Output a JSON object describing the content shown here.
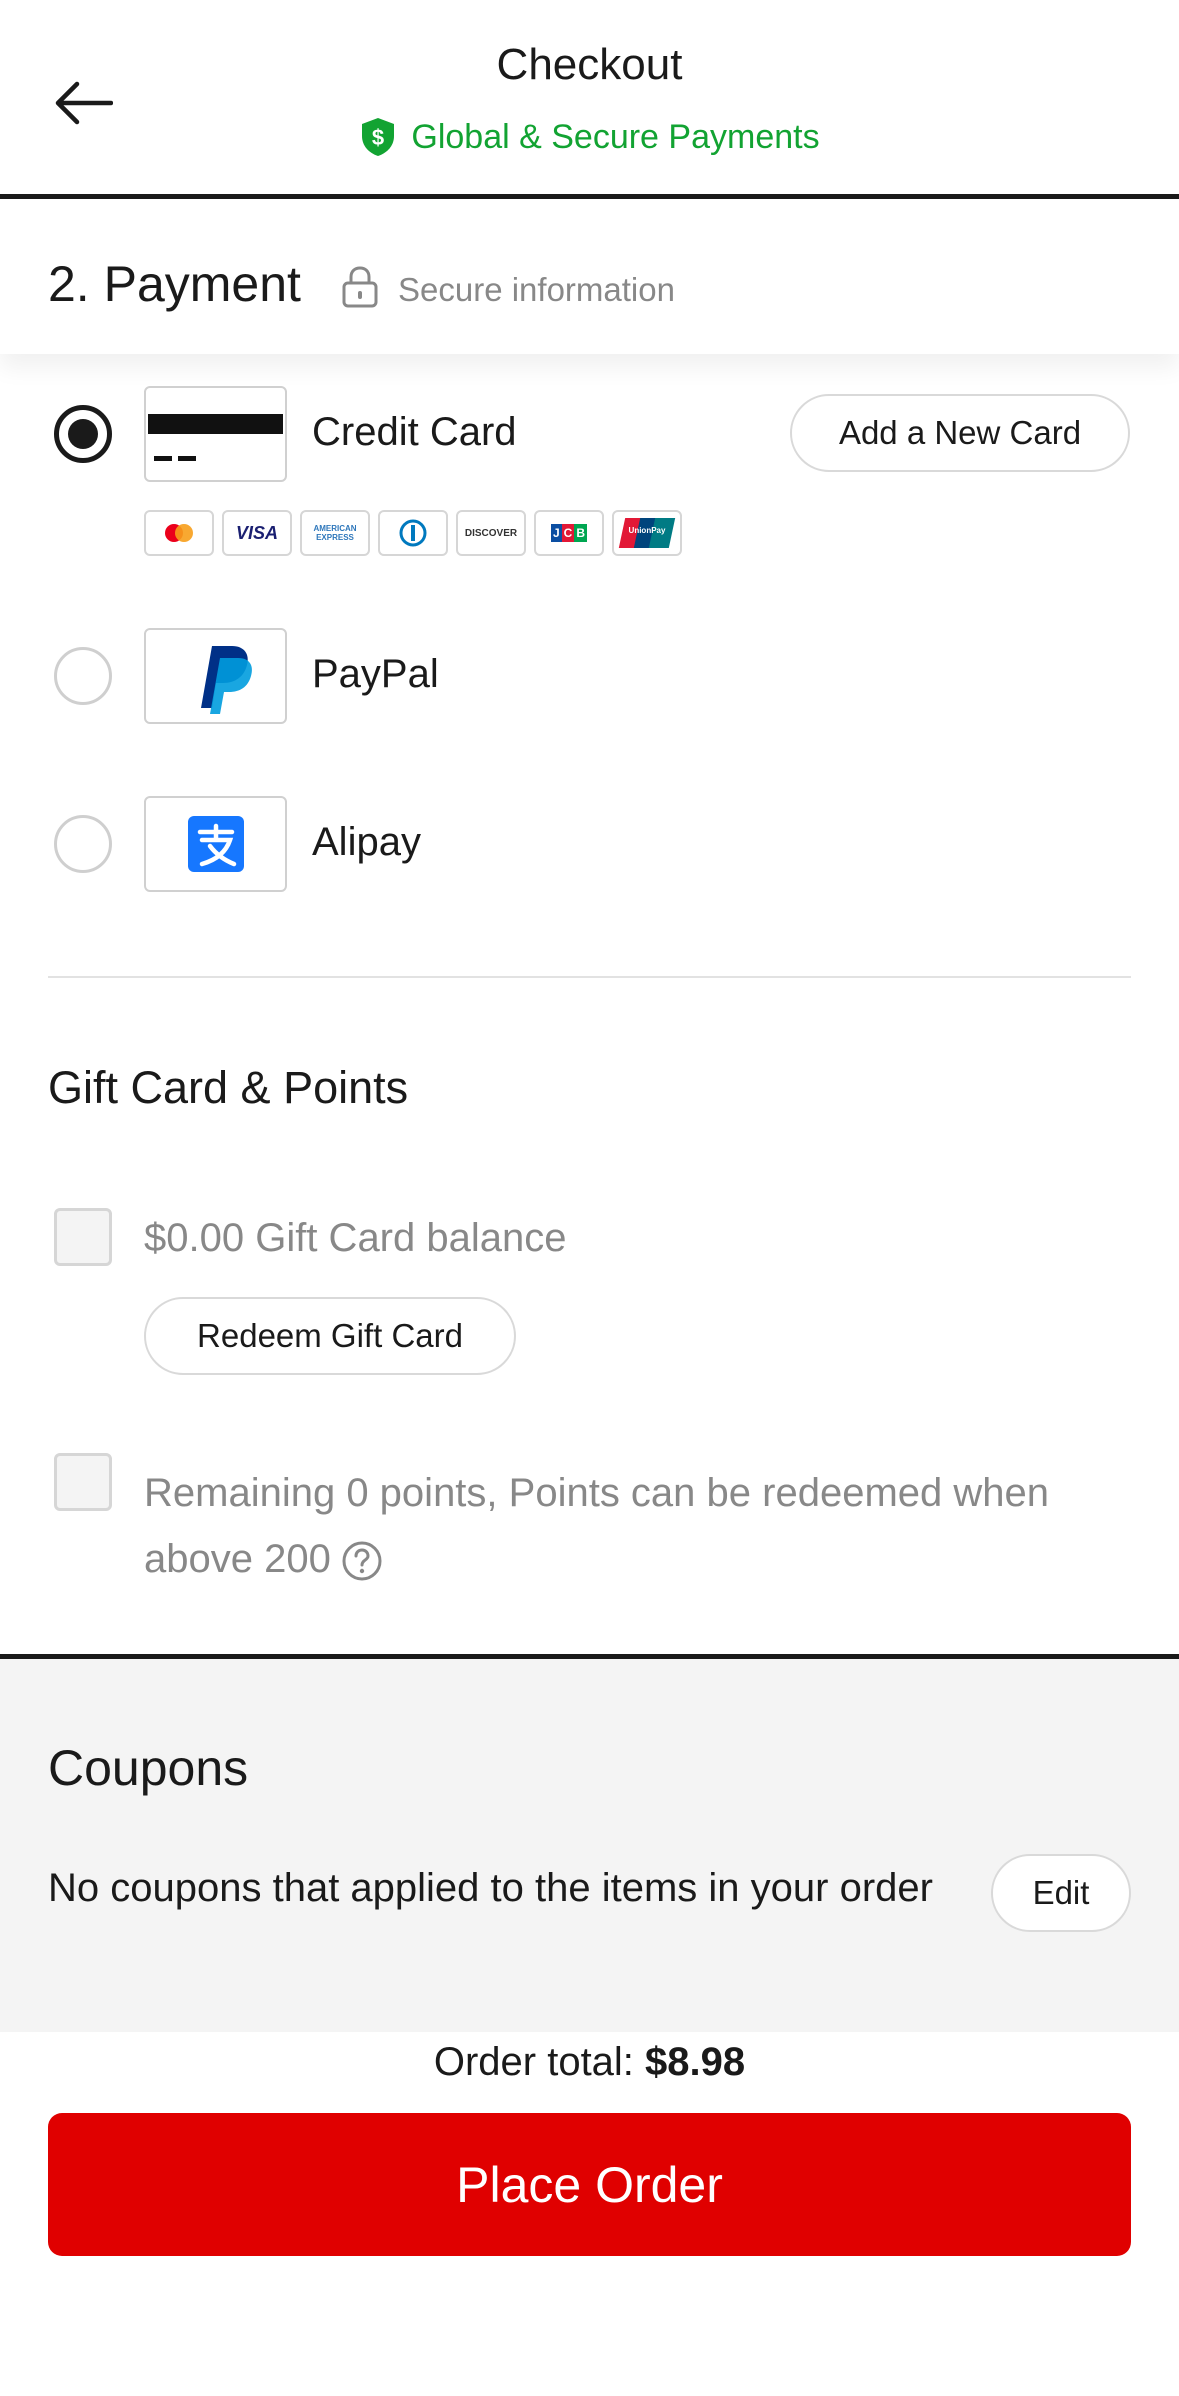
{
  "header": {
    "title": "Checkout",
    "secure_text": "Global & Secure Payments"
  },
  "payment": {
    "section_title": "2. Payment",
    "secure_info": "Secure information",
    "options": [
      {
        "label": "Credit Card",
        "selected": true,
        "icon": "credit-card-icon"
      },
      {
        "label": "PayPal",
        "selected": false,
        "icon": "paypal-icon"
      },
      {
        "label": "Alipay",
        "selected": false,
        "icon": "alipay-icon"
      }
    ],
    "add_card_label": "Add a New Card",
    "card_brands": [
      {
        "name": "mastercard-icon",
        "text": ""
      },
      {
        "name": "visa-icon",
        "text": "VISA"
      },
      {
        "name": "amex-icon",
        "text": "AMERICAN EXPRESS"
      },
      {
        "name": "diners-icon",
        "text": ""
      },
      {
        "name": "discover-icon",
        "text": "DISCOVER"
      },
      {
        "name": "jcb-icon",
        "text": "JCB"
      },
      {
        "name": "unionpay-icon",
        "text": "UnionPay"
      }
    ]
  },
  "gift": {
    "title": "Gift Card & Points",
    "balance_text": "$0.00 Gift Card balance",
    "redeem_label": "Redeem Gift Card",
    "points_text": "Remaining 0 points, Points can be redeemed when above 200"
  },
  "coupons": {
    "title": "Coupons",
    "text": "No coupons that applied to the items in your order",
    "edit_label": "Edit"
  },
  "footer": {
    "order_total_label": "Order total:",
    "order_total_value": "$8.98",
    "place_order_label": "Place Order"
  },
  "colors": {
    "accent_red": "#e00000",
    "secure_green": "#12a332",
    "paypal_dark": "#003087",
    "paypal_light": "#009cde",
    "alipay_blue": "#1677ff"
  }
}
